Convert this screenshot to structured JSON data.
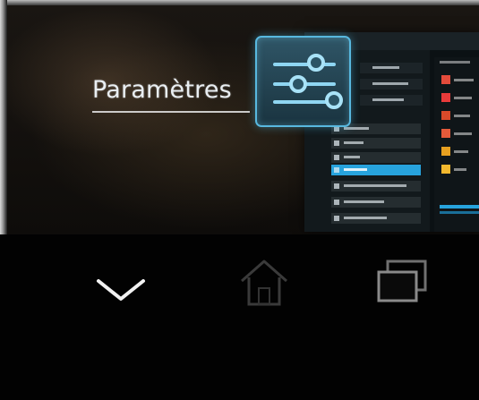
{
  "recent_apps": {
    "current_app": {
      "label": "Paramètres",
      "icon": "settings-sliders-icon"
    }
  },
  "navigation_bar": {
    "buttons": [
      {
        "name": "back",
        "icon": "chevron-down-icon"
      },
      {
        "name": "home",
        "icon": "home-icon"
      },
      {
        "name": "recent-apps",
        "icon": "recent-apps-icon"
      }
    ]
  },
  "colors": {
    "accent": "#33b5e5",
    "icon_border": "#58b8df",
    "selected_row": "#27a3dd",
    "nav_bg": "#020202"
  }
}
